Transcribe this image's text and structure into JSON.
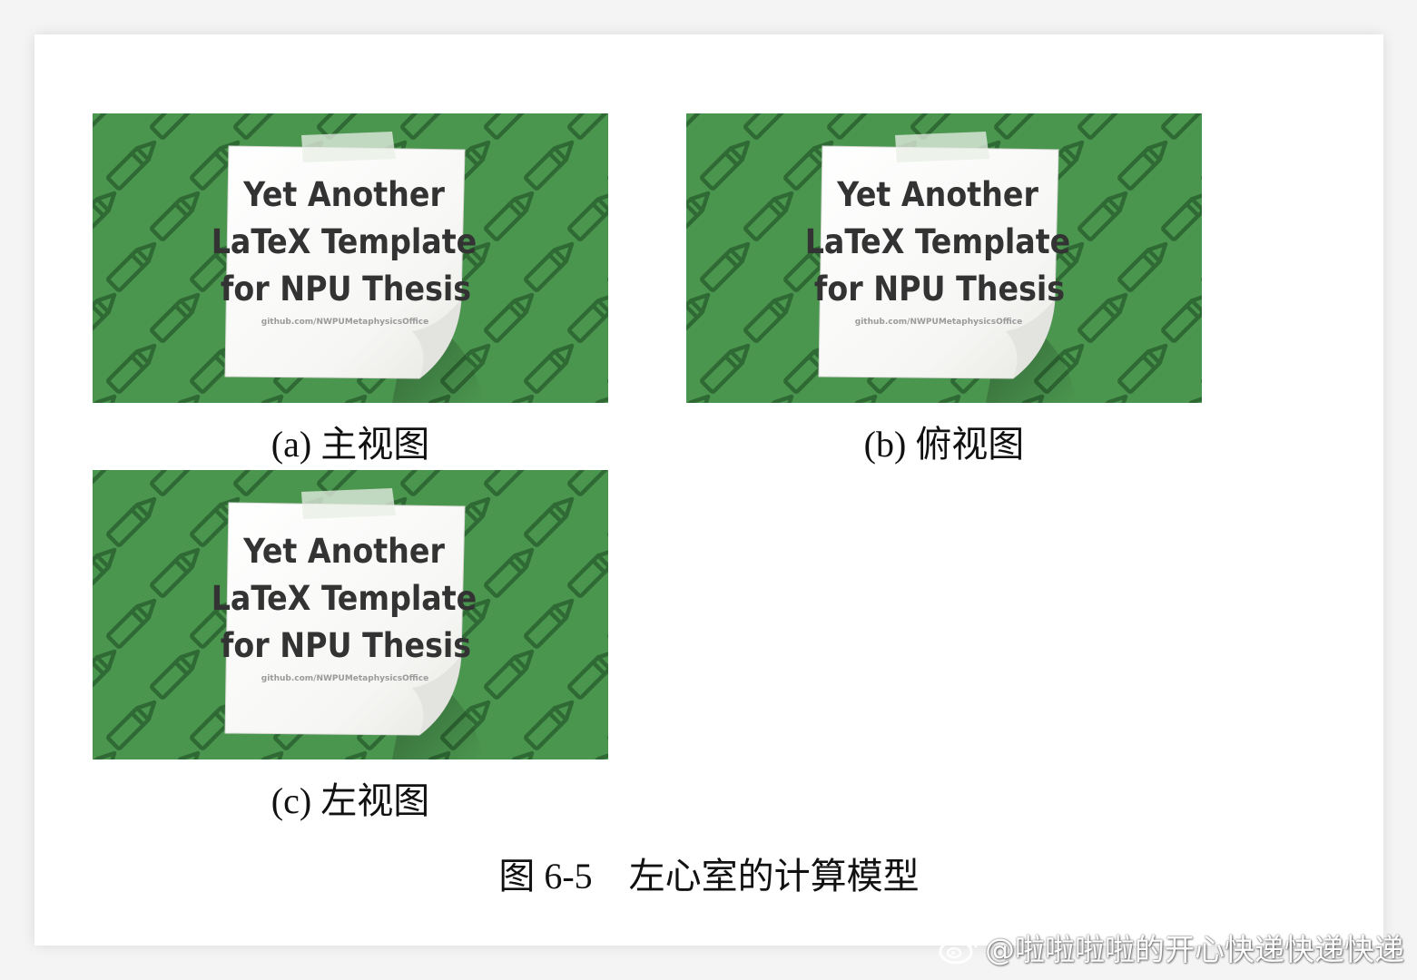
{
  "panel_image": {
    "title_lines": [
      "Yet Another",
      "LaTeX Template",
      "for NPU Thesis"
    ],
    "url": "github.com/NWPUMetaphysicsOffice",
    "background_color": "#4b964f",
    "pencil_color": "#2f6a34"
  },
  "subfigures": [
    {
      "caption": "(a) 主视图"
    },
    {
      "caption": "(b) 俯视图"
    },
    {
      "caption": "(c) 左视图"
    }
  ],
  "figure": {
    "caption": "图 6-5    左心室的计算模型"
  },
  "watermark": {
    "icon": "weibo-icon",
    "text": "@啦啦啦啦的开心快递快递快递"
  }
}
